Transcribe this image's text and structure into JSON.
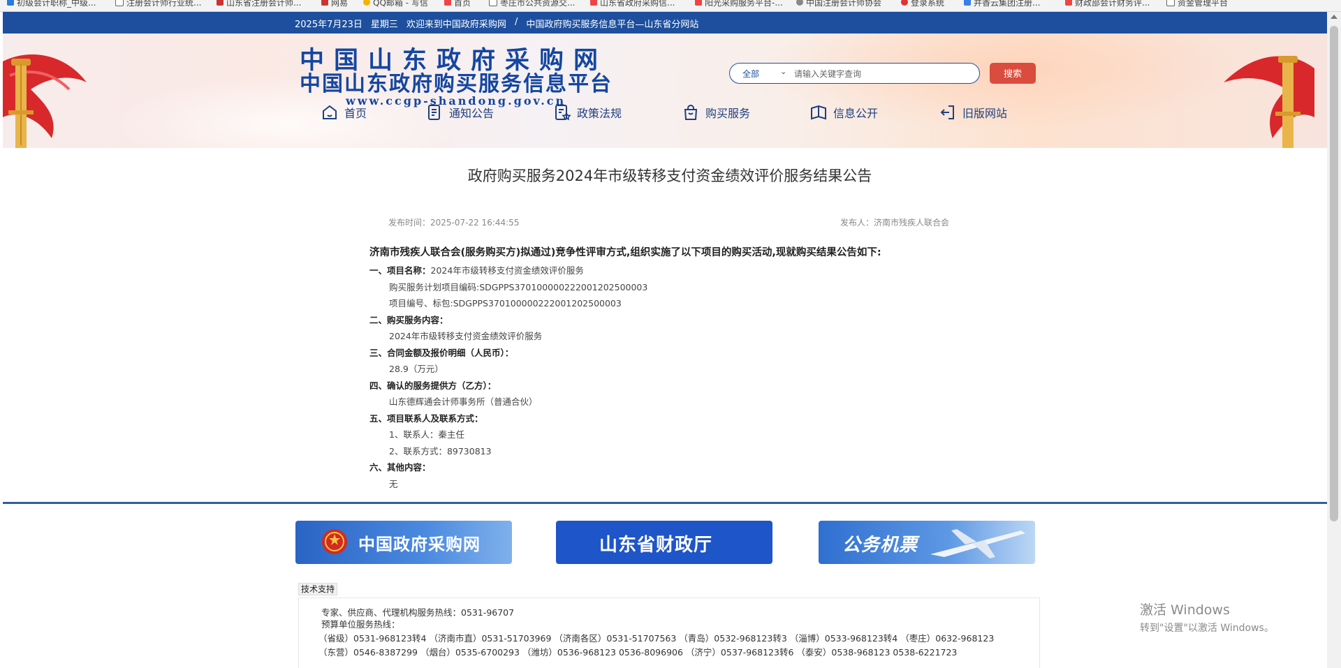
{
  "bookmarks": [
    "初级会计职称_中级...",
    "注册会计师行业统...",
    "山东省注册会计师...",
    "网易",
    "QQ邮箱 - 写信",
    "首页",
    "枣庄市公共资源交...",
    "山东省政府采购信...",
    "阳光采购服务平台-...",
    "中国注册会计师协会",
    "登录系统",
    "并香云集团注册...",
    "财政部会计财务评...",
    "资金管理平台"
  ],
  "topbar": {
    "date": "2025年7月23日",
    "weekday": "星期三",
    "welcome": "欢迎来到中国政府采购网",
    "separator": "/",
    "platform": "中国政府购买服务信息平台—山东省分网站"
  },
  "logo": {
    "line1": "中国山东政府采购网",
    "line2": "中国山东政府购买服务信息平台",
    "url": "www.ccgp-shandong.gov.cn"
  },
  "search": {
    "scope": "全部",
    "placeholder": "请输入关键字查询",
    "button": "搜索"
  },
  "nav": [
    {
      "label": "首页",
      "icon": "home-icon"
    },
    {
      "label": "通知公告",
      "icon": "notice-icon"
    },
    {
      "label": "政策法规",
      "icon": "policy-icon"
    },
    {
      "label": "购买服务",
      "icon": "shopping-bag-icon"
    },
    {
      "label": "信息公开",
      "icon": "open-book-icon"
    },
    {
      "label": "旧版网站",
      "icon": "exit-icon"
    }
  ],
  "article": {
    "title": "政府购买服务2024年市级转移支付资金绩效评价服务结果公告",
    "publish_time": "发布时间：2025-07-22 16:44:55",
    "publisher": "发布人：济南市残疾人联合会",
    "lead": "济南市残疾人联合会(服务购买方)拟通过)竞争性评审方式,组织实施了以下项目的购买活动,现就购买结果公告如下:",
    "s1_label": "一、项目名称：",
    "s1_value": "2024年市级转移支付资金绩效评价服务",
    "s1_plan": "购买服务计划项目编码:SDGPPS370100000222001202500003",
    "s1_code": "项目编号、标包:SDGPPS370100000222001202500003",
    "s2_label": "二、购买服务内容：",
    "s2_value": "2024年市级转移支付资金绩效评价服务",
    "s3_label": "三、合同金额及报价明细（人民币）：",
    "s3_value": "28.9（万元）",
    "s4_label": "四、确认的服务提供方（乙方）：",
    "s4_value": "山东德辉通会计师事务所（普通合伙）",
    "s5_label": "五、项目联系人及联系方式：",
    "s5_contact": "1、联系人：秦主任",
    "s5_phone": "2、联系方式：89730813",
    "s6_label": "六、其他内容：",
    "s6_value": "无"
  },
  "banners": [
    {
      "label": "中国政府采购网",
      "color": "#2f6fcf"
    },
    {
      "label": "山东省财政厅",
      "color": "#1e55c8"
    },
    {
      "label": "公务机票",
      "color": "#3b7ad8"
    }
  ],
  "tech": {
    "label": "技术支持",
    "hotline": "专家、供应商、代理机构服务热线：0531-96707",
    "budget": "预算单位服务热线：",
    "line1": "（省级）0531-968123转4  （济南市直）0531-51703969  （济南各区）0531-51707563  （青岛）0532-968123转3  （淄博）0533-968123转4  （枣庄）0632-968123",
    "line2": "（东营）0546-8387299  （烟台）0535-6700293  （潍坊）0536-968123  0536-8096906  （济宁）0537-968123转6  （泰安）0538-968123  0538-6221723"
  },
  "watermark": {
    "line1": "激活 Windows",
    "line2": "转到\"设置\"以激活 Windows。"
  }
}
